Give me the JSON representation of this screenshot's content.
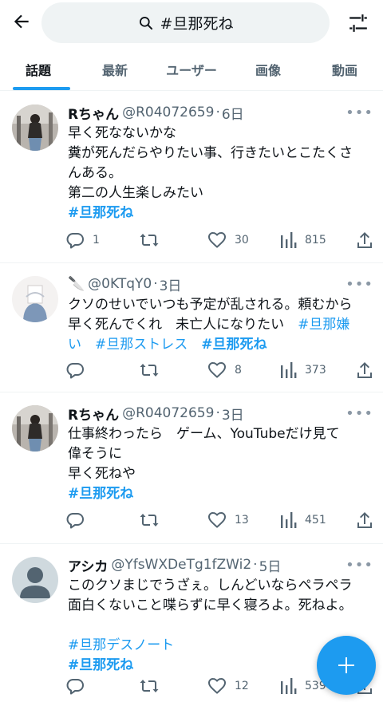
{
  "search": {
    "query": "#旦那死ね"
  },
  "tabs": [
    {
      "label": "話題"
    },
    {
      "label": "最新"
    },
    {
      "label": "ユーザー"
    },
    {
      "label": "画像"
    },
    {
      "label": "動画"
    }
  ],
  "colors": {
    "accent": "#1d9bf0",
    "text": "#0f1419",
    "muted": "#536471"
  },
  "icons": [
    "back-arrow-icon",
    "search-icon",
    "filter-sliders-icon",
    "more-icon",
    "reply-icon",
    "retweet-icon",
    "like-icon",
    "views-icon",
    "share-icon",
    "compose-plus-icon"
  ],
  "tweets": [
    {
      "name": "Rちゃん",
      "handle": "@R04072659",
      "dot": "·",
      "time": "6日",
      "more": "•••",
      "lines": [
        "早く死なないかな",
        "糞が死んだらやりたい事、行きたいとこたくさ",
        "んある。",
        "第二の人生楽しみたい"
      ],
      "hashtag": "#旦那死ね",
      "replies": "1",
      "retweets": "",
      "likes": "30",
      "views": "815"
    },
    {
      "name": "🔪",
      "handle": "@0KTqY0",
      "dot": "·",
      "time": "3日",
      "more": "•••",
      "lines": [
        "クソのせいでいつも予定が乱される。頼むから",
        "早く死んでくれ　未亡人になりたい"
      ],
      "tag_a": "#旦那嫌",
      "tag_a2": "い",
      "tag_b": "#旦那ストレス",
      "tag_c": "#旦那死ね",
      "replies": "",
      "retweets": "",
      "likes": "8",
      "views": "373"
    },
    {
      "name": "Rちゃん",
      "handle": "@R04072659",
      "dot": "·",
      "time": "3日",
      "more": "•••",
      "lines": [
        "仕事終わったら　ゲーム、YouTubeだけ見て",
        "偉そうに",
        "早く死ねや"
      ],
      "hashtag": "#旦那死ね",
      "replies": "",
      "retweets": "",
      "likes": "13",
      "views": "451"
    },
    {
      "name": "アシカ",
      "handle": "@YfsWXDeTg1fZWi2",
      "dot": "·",
      "time": "5日",
      "more": "•••",
      "lines": [
        "このクソまじでうざぇ。しんどいならペラペラ",
        "面白くないこと喋らずに早く寝ろよ。死ねよ。"
      ],
      "tag_a": "#旦那デスノート",
      "hashtag": "#旦那死ね",
      "replies": "",
      "retweets": "",
      "likes": "12",
      "views": "539"
    }
  ]
}
